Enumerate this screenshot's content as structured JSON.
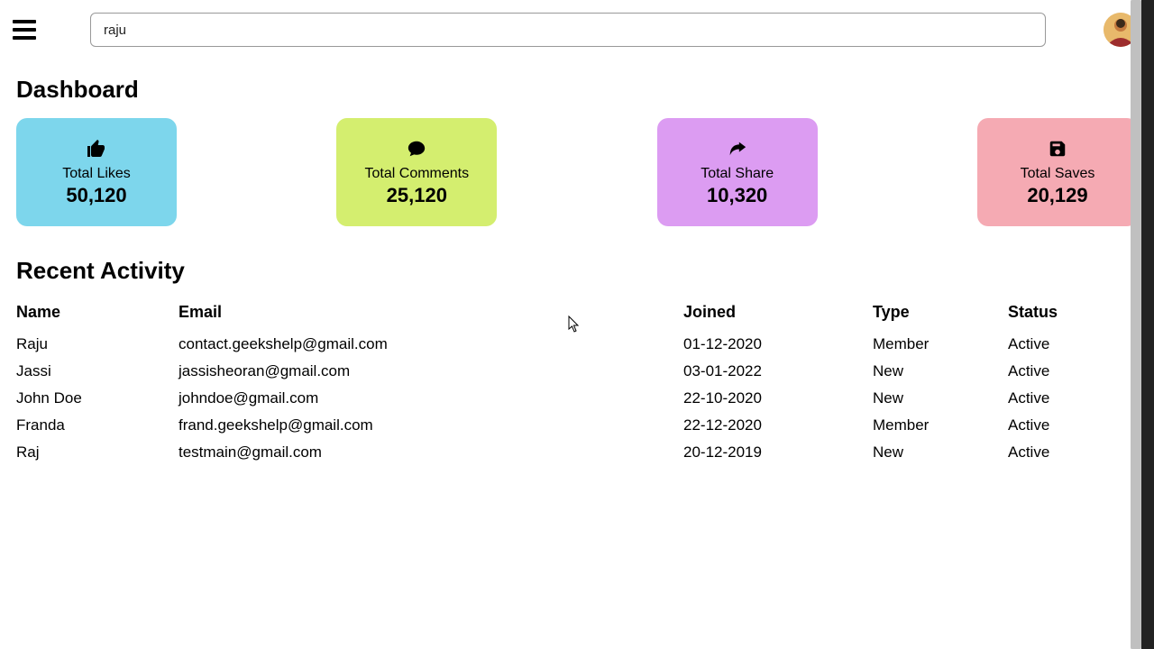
{
  "search": {
    "value": "raju"
  },
  "page_title": "Dashboard",
  "cards": [
    {
      "icon": "thumbs-up-icon",
      "label": "Total Likes",
      "value": "50,120",
      "colorClass": "card-blue"
    },
    {
      "icon": "comment-icon",
      "label": "Total Comments",
      "value": "25,120",
      "colorClass": "card-green"
    },
    {
      "icon": "share-icon",
      "label": "Total Share",
      "value": "10,320",
      "colorClass": "card-purple"
    },
    {
      "icon": "save-icon",
      "label": "Total Saves",
      "value": "20,129",
      "colorClass": "card-pink"
    }
  ],
  "activity_title": "Recent Activity",
  "activity": {
    "columns": [
      "Name",
      "Email",
      "Joined",
      "Type",
      "Status"
    ],
    "rows": [
      {
        "name": "Raju",
        "email": "contact.geekshelp@gmail.com",
        "joined": "01-12-2020",
        "type": "Member",
        "status": "Active"
      },
      {
        "name": "Jassi",
        "email": "jassisheoran@gmail.com",
        "joined": "03-01-2022",
        "type": "New",
        "status": "Active"
      },
      {
        "name": "John Doe",
        "email": "johndoe@gmail.com",
        "joined": "22-10-2020",
        "type": "New",
        "status": "Active"
      },
      {
        "name": "Franda",
        "email": "frand.geekshelp@gmail.com",
        "joined": "22-12-2020",
        "type": "Member",
        "status": "Active"
      },
      {
        "name": "Raj",
        "email": "testmain@gmail.com",
        "joined": "20-12-2019",
        "type": "New",
        "status": "Active"
      }
    ]
  }
}
